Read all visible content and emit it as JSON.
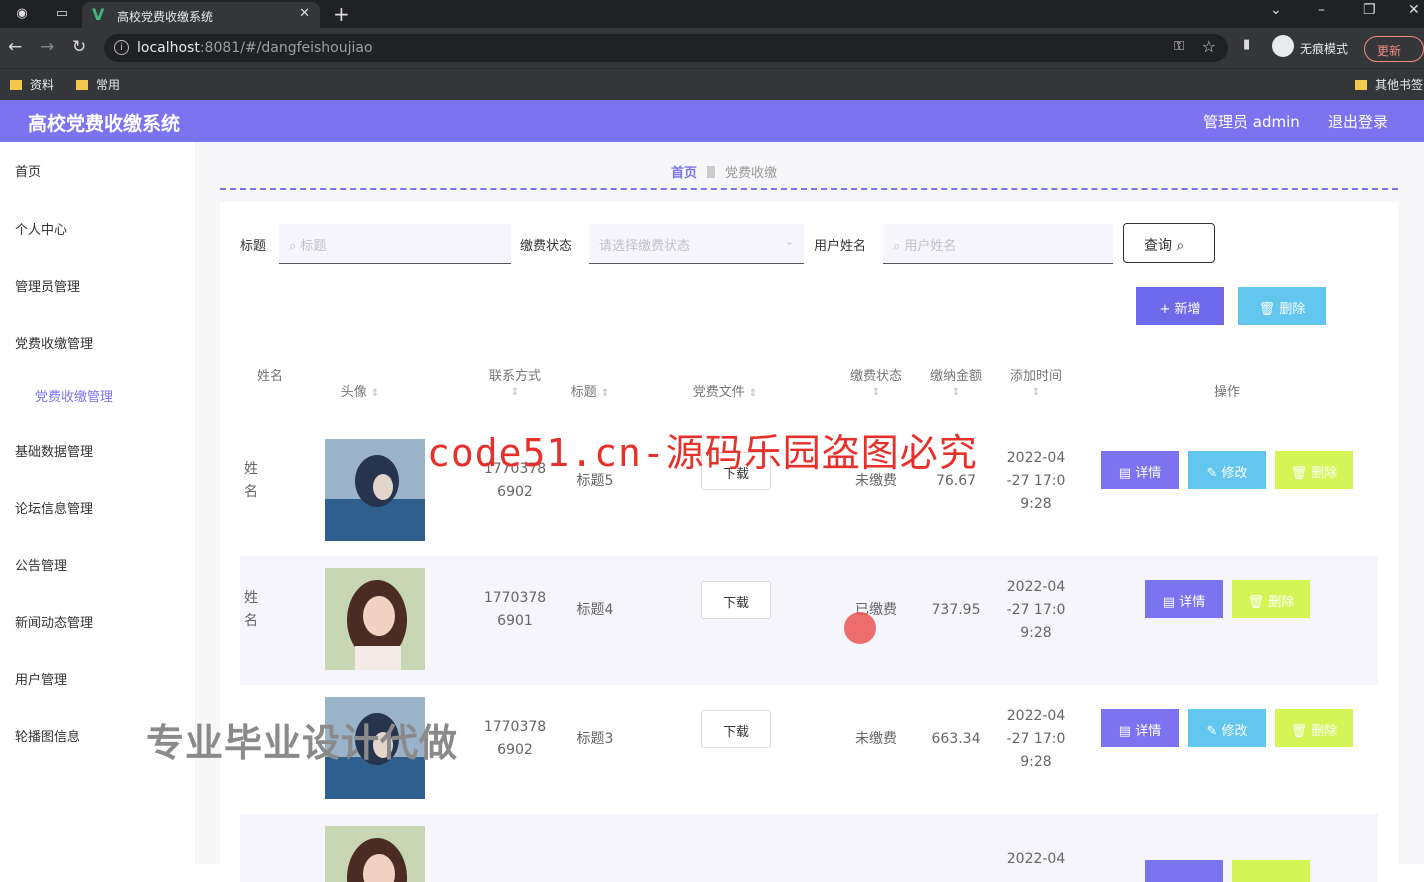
{
  "browser": {
    "tab_title": "高校党费收缴系统",
    "url_host": "localhost",
    "url_rest": ":8081/#/dangfeishoujiao",
    "incognito_label": "无痕模式",
    "update_label": "更新",
    "bookmarks": [
      "资料",
      "常用"
    ],
    "other_bookmarks": "其他书签"
  },
  "header": {
    "title": "高校党费收缴系统",
    "user": "管理员 admin",
    "logout": "退出登录",
    "color": "#7b73f0"
  },
  "sidebar": {
    "items": [
      "首页",
      "个人中心",
      "管理员管理",
      "党费收缴管理",
      "基础数据管理",
      "论坛信息管理",
      "公告管理",
      "新闻动态管理",
      "用户管理",
      "轮播图信息"
    ],
    "sub_item": "党费收缴管理"
  },
  "breadcrumb": {
    "home": "首页",
    "current": "党费收缴"
  },
  "search": {
    "title_label": "标题",
    "title_placeholder": "标题",
    "status_label": "缴费状态",
    "status_placeholder": "请选择缴费状态",
    "name_label": "用户姓名",
    "name_placeholder": "用户姓名",
    "query_button": "查询"
  },
  "actions": {
    "add": "新增",
    "delete": "删除"
  },
  "table": {
    "columns": [
      "姓名",
      "头像",
      "联系方式",
      "标题",
      "党费文件",
      "缴费状态",
      "缴纳金额",
      "添加时间",
      "操作"
    ],
    "rows": [
      {
        "name": "姓名",
        "phone_1": "1770378",
        "phone_2": "6902",
        "title": "标题5",
        "file": "下载",
        "status": "未缴费",
        "amount": "76.67",
        "time_1": "2022-04",
        "time_2": "-27 17:0",
        "time_3": "9:28",
        "btn_detail": "详情",
        "btn_edit": "修改",
        "btn_delete": "删除"
      },
      {
        "name": "姓名",
        "phone_1": "1770378",
        "phone_2": "6901",
        "title": "标题4",
        "file": "下载",
        "status": "已缴费",
        "amount": "737.95",
        "time_1": "2022-04",
        "time_2": "-27 17:0",
        "time_3": "9:28",
        "btn_detail": "详情",
        "btn_delete": "删除"
      },
      {
        "name": "姓名",
        "phone_1": "1770378",
        "phone_2": "6902",
        "title": "标题3",
        "file": "下载",
        "status": "未缴费",
        "amount": "663.34",
        "time_1": "2022-04",
        "time_2": "-27 17:0",
        "time_3": "9:28",
        "btn_detail": "详情",
        "btn_edit": "修改",
        "btn_delete": "删除"
      },
      {
        "time_1": "2022-04"
      }
    ]
  },
  "overlay": {
    "red_text": "code51.cn-源码乐园盗图必究",
    "grey_text": "专业毕业设计代做"
  }
}
